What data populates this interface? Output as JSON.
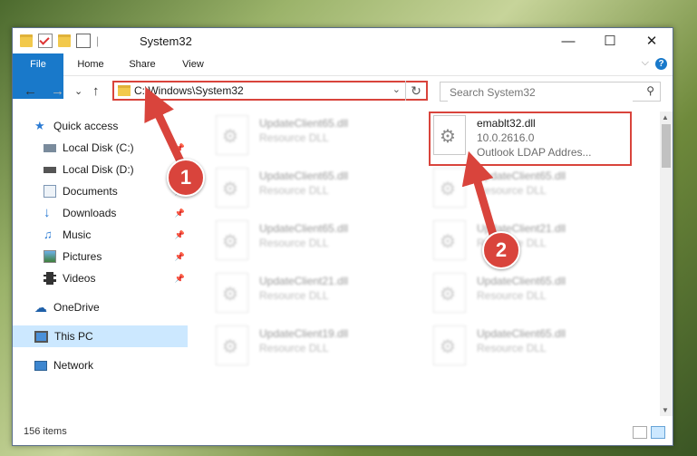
{
  "window": {
    "title": "System32",
    "minimize_glyph": "—",
    "maximize_glyph": "☐",
    "close_glyph": "✕"
  },
  "ribbon": {
    "tabs": [
      "File",
      "Home",
      "Share",
      "View"
    ],
    "help_glyph": "?",
    "collapse_glyph": "⌵"
  },
  "navigation": {
    "back_glyph": "←",
    "forward_glyph": "→",
    "recent_glyph": "⌄",
    "up_glyph": "↑"
  },
  "address_bar": {
    "path": "C:\\Windows\\System32",
    "dropdown_glyph": "⌄",
    "refresh_glyph": "↻"
  },
  "search": {
    "placeholder": "Search System32",
    "icon_glyph": "⚲"
  },
  "sidebar": {
    "items": [
      {
        "label": "Quick access",
        "icon": "star-icon",
        "pinned": false
      },
      {
        "label": "Local Disk (C:)",
        "icon": "drive-icon",
        "pinned": true
      },
      {
        "label": "Local Disk (D:)",
        "icon": "drive-icon",
        "pinned": false
      },
      {
        "label": "Documents",
        "icon": "documents-icon",
        "pinned": true
      },
      {
        "label": "Downloads",
        "icon": "download-icon",
        "pinned": true
      },
      {
        "label": "Music",
        "icon": "music-icon",
        "pinned": true
      },
      {
        "label": "Pictures",
        "icon": "pictures-icon",
        "pinned": true
      },
      {
        "label": "Videos",
        "icon": "videos-icon",
        "pinned": true
      },
      {
        "label": "OneDrive",
        "icon": "cloud-icon",
        "pinned": false
      },
      {
        "label": "This PC",
        "icon": "computer-icon",
        "pinned": false
      },
      {
        "label": "Network",
        "icon": "network-icon",
        "pinned": false
      }
    ],
    "pin_glyph": "📌"
  },
  "files": [
    {
      "name": "UpdateClient65.dll",
      "type": "Resource DLL"
    },
    {
      "name": "emablt32.dll",
      "version": "10.0.2616.0",
      "description": "Outlook LDAP Addres..."
    },
    {
      "name": "UpdateClient65.dll",
      "type": "Resource DLL"
    },
    {
      "name": "UpdateClient65.dll",
      "type": "Resource DLL"
    },
    {
      "name": "UpdateClient65.dll",
      "type": "Resource DLL"
    },
    {
      "name": "UpdateClient21.dll",
      "type": "Resource DLL"
    },
    {
      "name": "UpdateClient21.dll",
      "type": "Resource DLL"
    },
    {
      "name": "UpdateClient65.dll",
      "type": "Resource DLL"
    },
    {
      "name": "UpdateClient19.dll",
      "type": "Resource DLL"
    },
    {
      "name": "UpdateClient65.dll",
      "type": "Resource DLL"
    }
  ],
  "status": {
    "item_count": "156 items"
  },
  "annotations": {
    "step1": "1",
    "step2": "2",
    "color": "#d9443c"
  }
}
